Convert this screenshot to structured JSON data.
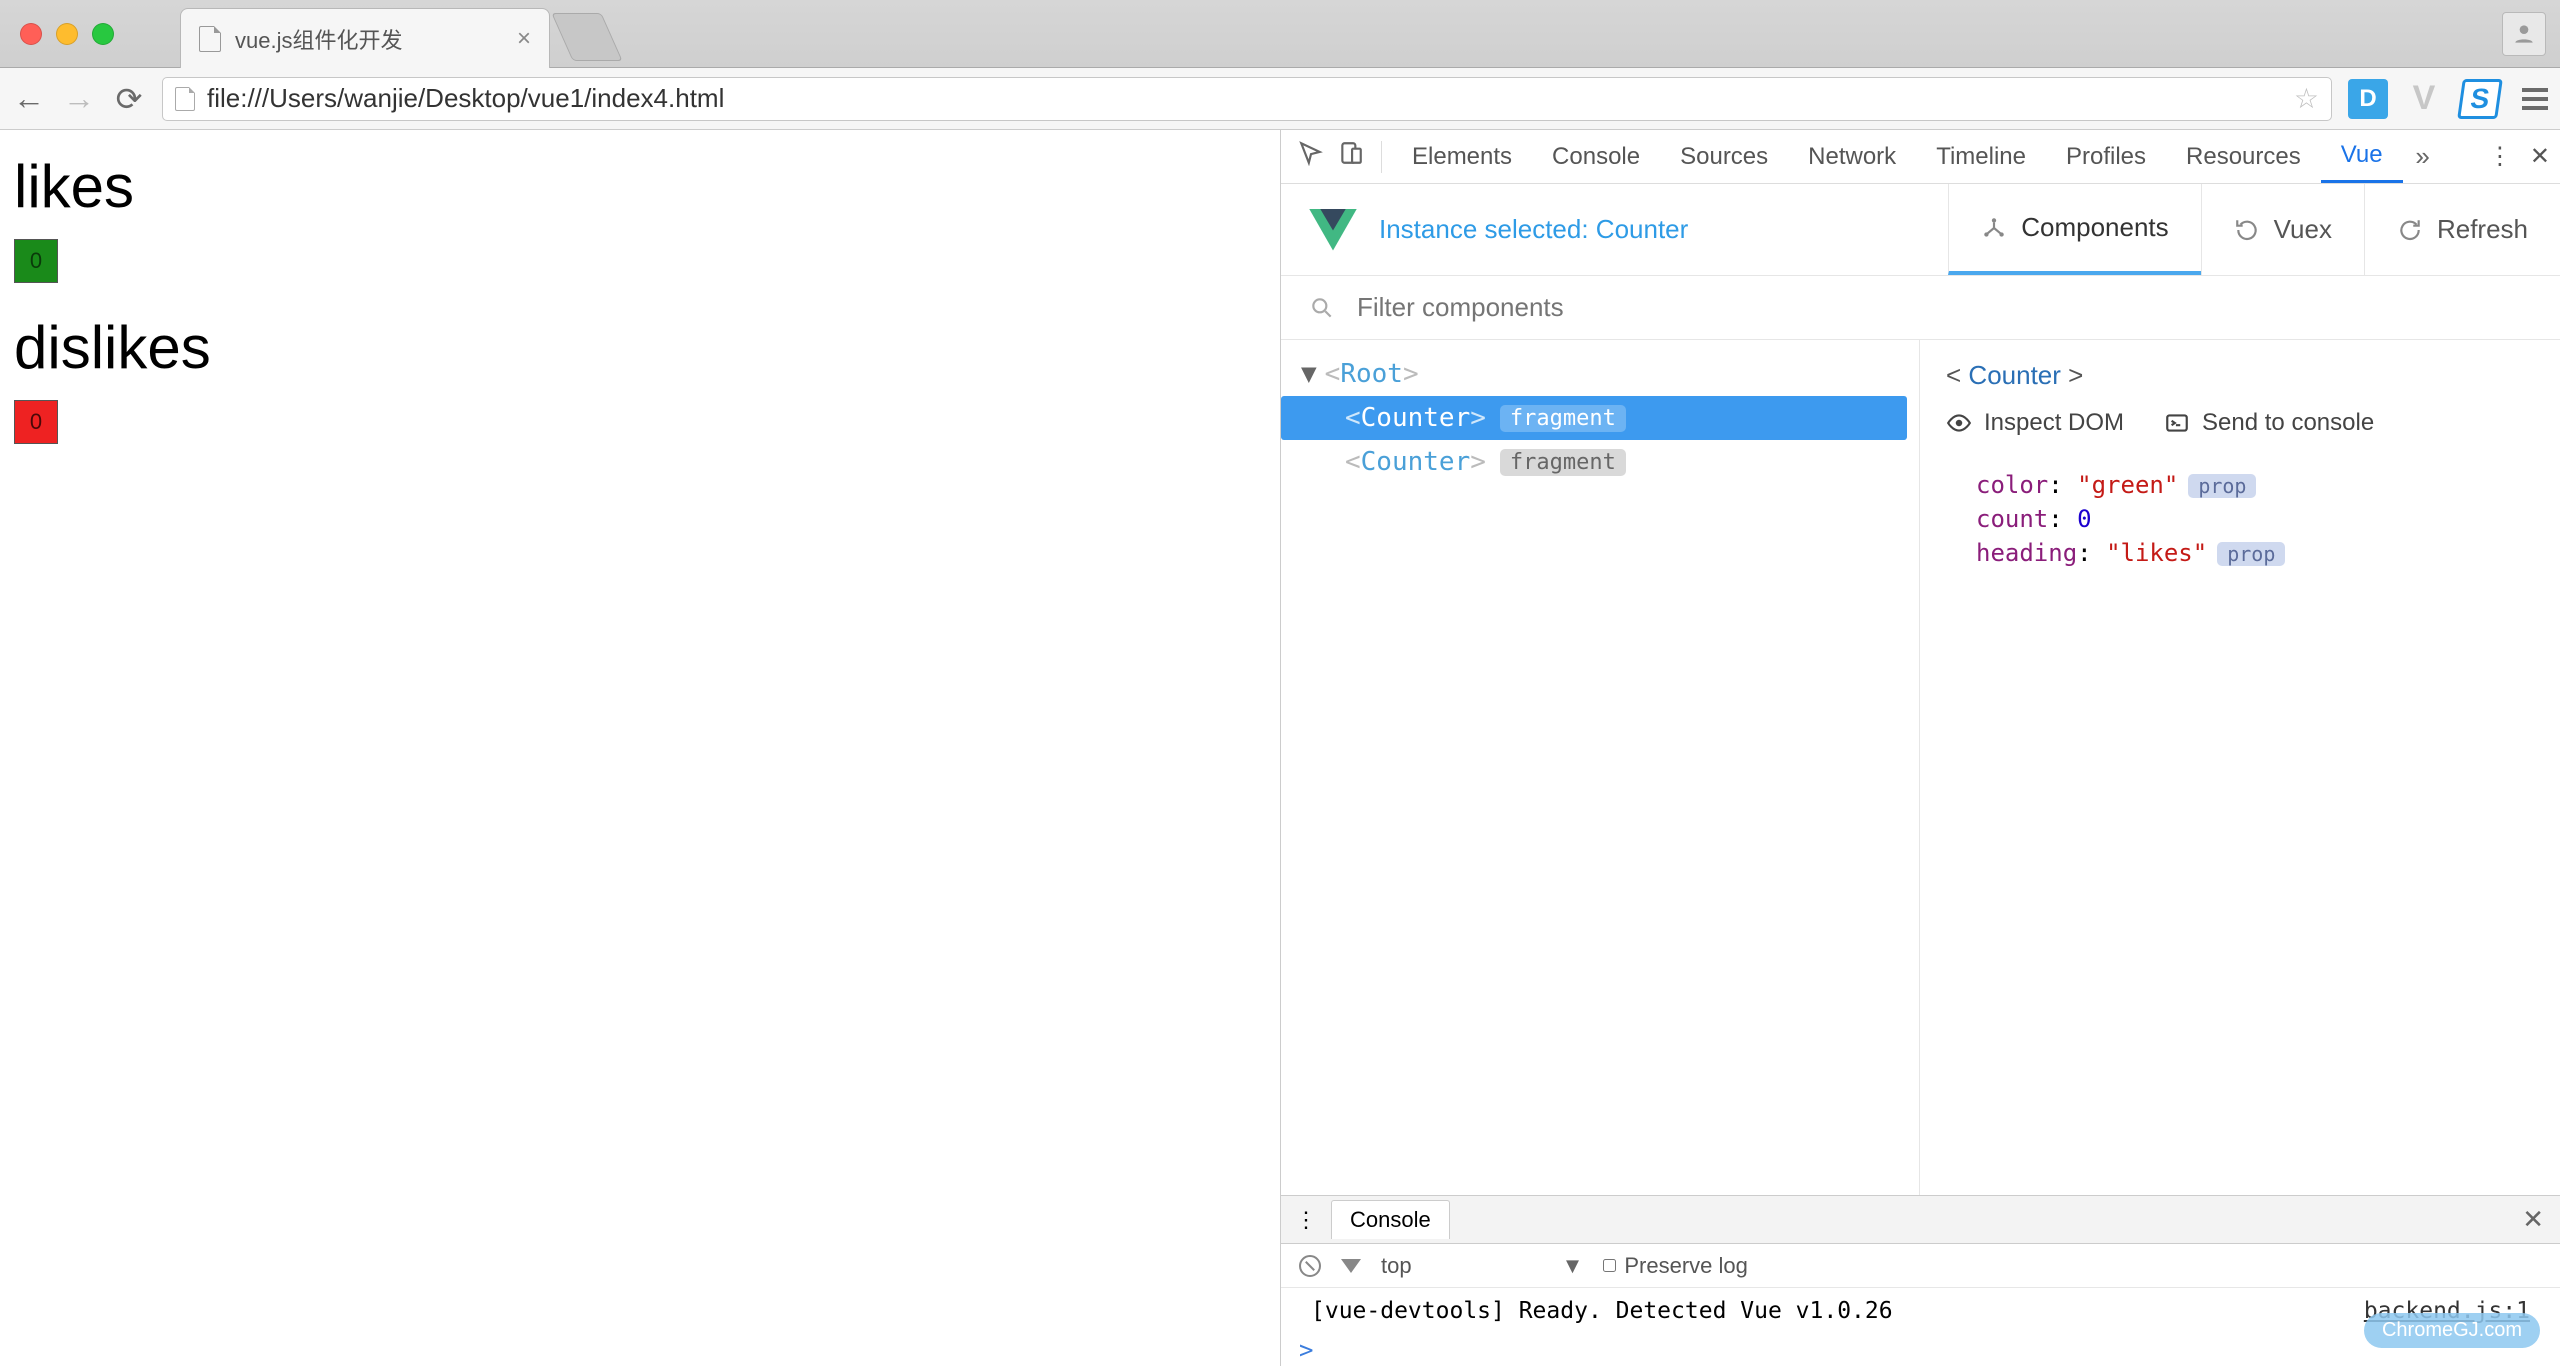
{
  "browser": {
    "tab_title": "vue.js组件化开发",
    "url": "file:///Users/wanjie/Desktop/vue1/index4.html",
    "extensions": [
      "D",
      "V",
      "S"
    ]
  },
  "page": {
    "sections": [
      {
        "heading": "likes",
        "count": 0,
        "color": "green"
      },
      {
        "heading": "dislikes",
        "count": 0,
        "color": "red"
      }
    ]
  },
  "devtools": {
    "tabs": [
      "Elements",
      "Console",
      "Sources",
      "Network",
      "Timeline",
      "Profiles",
      "Resources",
      "Vue"
    ],
    "active_tab": "Vue",
    "vue": {
      "instance_selected": "Instance selected: Counter",
      "tabs": {
        "components": "Components",
        "vuex": "Vuex",
        "refresh": "Refresh"
      },
      "filter_placeholder": "Filter components",
      "tree": {
        "root": "Root",
        "children": [
          {
            "name": "Counter",
            "badge": "fragment",
            "selected": true
          },
          {
            "name": "Counter",
            "badge": "fragment",
            "selected": false
          }
        ]
      },
      "props": {
        "title": "Counter",
        "actions": {
          "inspect": "Inspect DOM",
          "send": "Send to console"
        },
        "values": [
          {
            "key": "color",
            "value": "\"green\"",
            "type": "string",
            "pill": "prop"
          },
          {
            "key": "count",
            "value": "0",
            "type": "number"
          },
          {
            "key": "heading",
            "value": "\"likes\"",
            "type": "string",
            "pill": "prop"
          }
        ]
      }
    },
    "drawer": {
      "tab": "Console",
      "context": "top",
      "preserve_label": "Preserve log",
      "message": "[vue-devtools] Ready. Detected Vue v1.0.26",
      "source": "backend.js:1"
    }
  },
  "watermark": "ChromeGJ.com"
}
